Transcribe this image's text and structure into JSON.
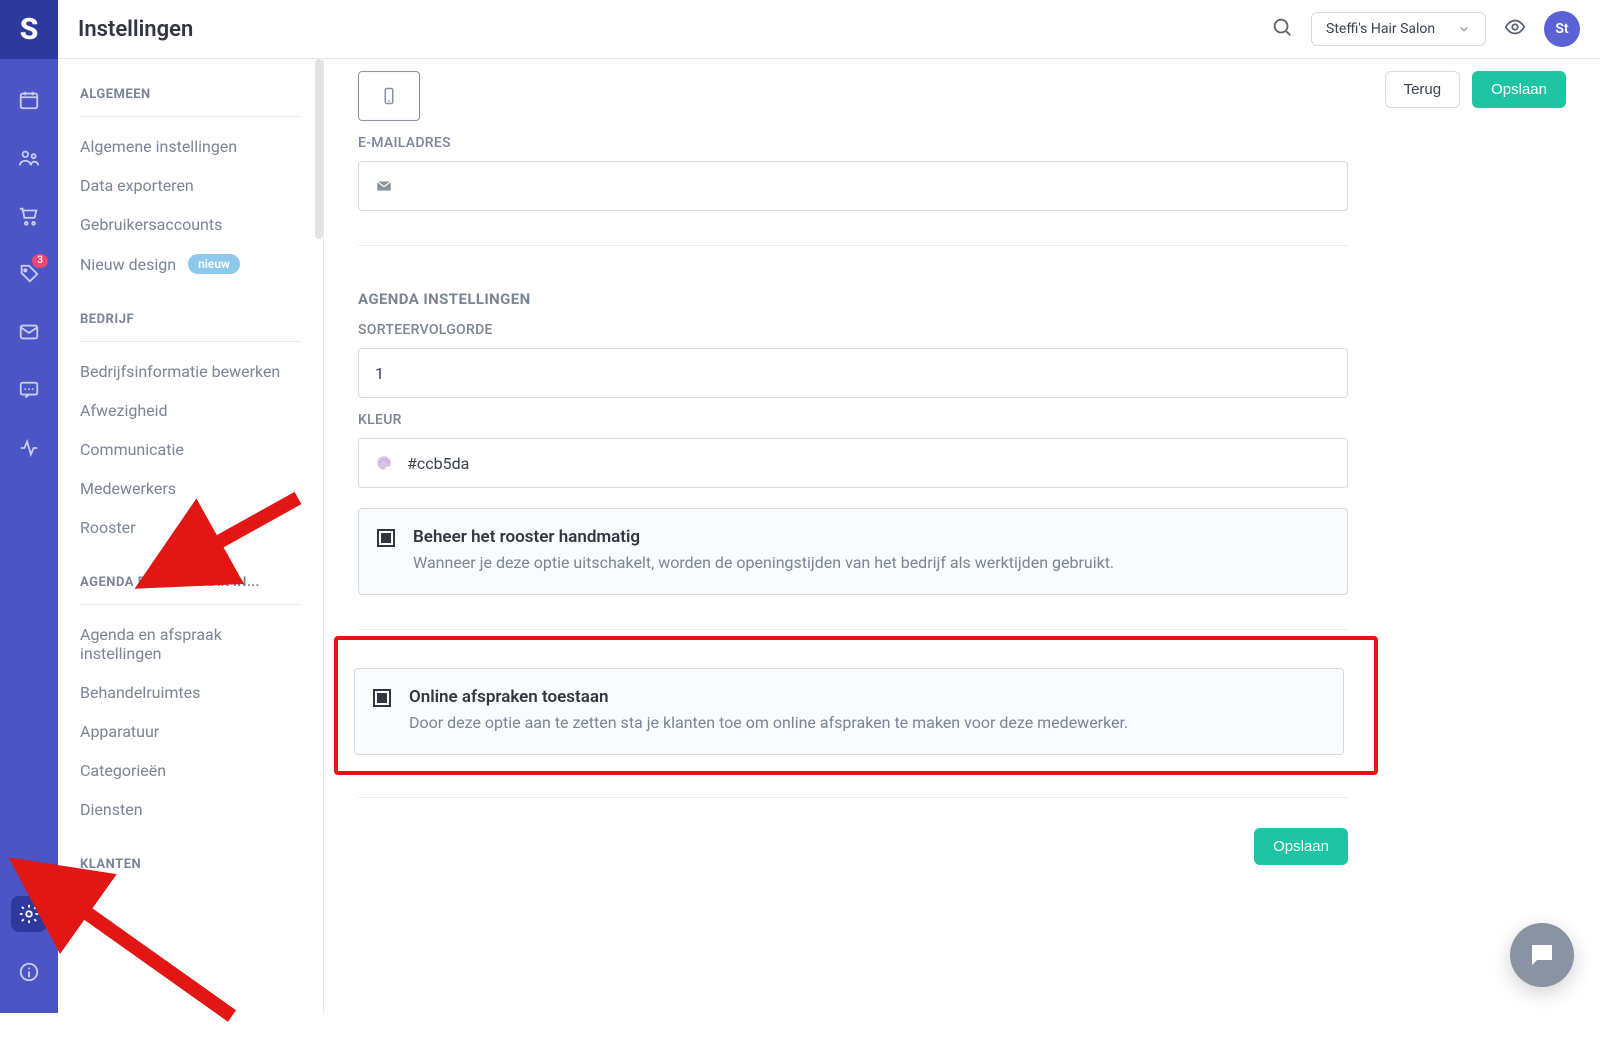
{
  "header": {
    "title": "Instellingen",
    "salon": "Steffi's Hair Salon",
    "avatar": "St"
  },
  "rail": {
    "badge": "3"
  },
  "settings_nav": {
    "groups": [
      {
        "title": "ALGEMEEN",
        "items": [
          {
            "label": "Algemene instellingen"
          },
          {
            "label": "Data exporteren"
          },
          {
            "label": "Gebruikersaccounts"
          },
          {
            "label": "Nieuw design",
            "badge": "nieuw"
          }
        ]
      },
      {
        "title": "BEDRIJF",
        "items": [
          {
            "label": "Bedrijfsinformatie bewerken"
          },
          {
            "label": "Afwezigheid"
          },
          {
            "label": "Communicatie"
          },
          {
            "label": "Medewerkers"
          },
          {
            "label": "Rooster"
          }
        ]
      },
      {
        "title": "AGENDA EN AFSPRAAK IN...",
        "items": [
          {
            "label": "Agenda en afspraak instellingen"
          },
          {
            "label": "Behandelruimtes"
          },
          {
            "label": "Apparatuur"
          },
          {
            "label": "Categorieën"
          },
          {
            "label": "Diensten"
          }
        ]
      },
      {
        "title": "KLANTEN",
        "items": []
      }
    ]
  },
  "form": {
    "actions": {
      "back": "Terug",
      "save": "Opslaan"
    },
    "email_label": "E-MAILADRES",
    "agenda_section": "AGENDA INSTELLINGEN",
    "sort_label": "SORTEERVOLGORDE",
    "sort_value": "1",
    "color_label": "KLEUR",
    "color_value": "#ccb5da",
    "roster": {
      "title": "Beheer het rooster handmatig",
      "desc": "Wanneer je deze optie uitschakelt, worden de openingstijden van het bedrijf als werktijden gebruikt."
    },
    "online": {
      "title": "Online afspraken toestaan",
      "desc": "Door deze optie aan te zetten sta je klanten toe om online afspraken te maken voor deze medewerker."
    },
    "save_footer": "Opslaan"
  }
}
